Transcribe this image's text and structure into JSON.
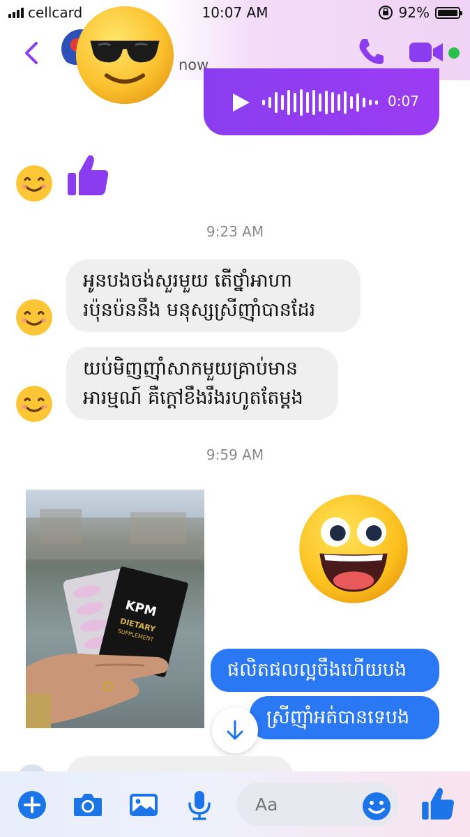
{
  "status_bar": {
    "carrier": "cellcard",
    "time": "10:07 AM",
    "battery": "92%",
    "battery_level": 0.92
  },
  "header": {
    "presence_text": "now",
    "icons": [
      "back-chevron-icon",
      "phone-icon",
      "video-camera-icon"
    ],
    "accent_color": "#8a3df0",
    "online_color": "#27c04b"
  },
  "voice_message": {
    "duration": "0:07"
  },
  "timestamps": [
    "9:23 AM",
    "9:59 AM"
  ],
  "messages": {
    "incoming_1": [
      "អូនបងចង់សួរមួយ តើថ្នាំអាហា",
      "រប៉ុនប៉ននឹង មនុស្សស្រីញ៉ាំបានដែរ"
    ],
    "incoming_2": [
      "យប់មិញញ៉ាំសាកមួយគ្រាប់មាន",
      "អារម្មណ៍ គឺក្តៅខឹងរឹងរហូតតែម្តង"
    ],
    "outgoing_1": "ផលិតផលល្អចឹងហើយបង",
    "outgoing_2": "ស្រីញ៉ាំអត់បានទេបង"
  },
  "photo": {
    "package_brand": "KPM",
    "package_text": "DIETARY SUPPLEMENT"
  },
  "composer": {
    "placeholder": "Aa",
    "icons": [
      "plus-icon",
      "camera-icon",
      "image-icon",
      "microphone-icon",
      "emoji-icon",
      "thumbs-up-icon"
    ],
    "icon_color": "#1b74e8"
  }
}
